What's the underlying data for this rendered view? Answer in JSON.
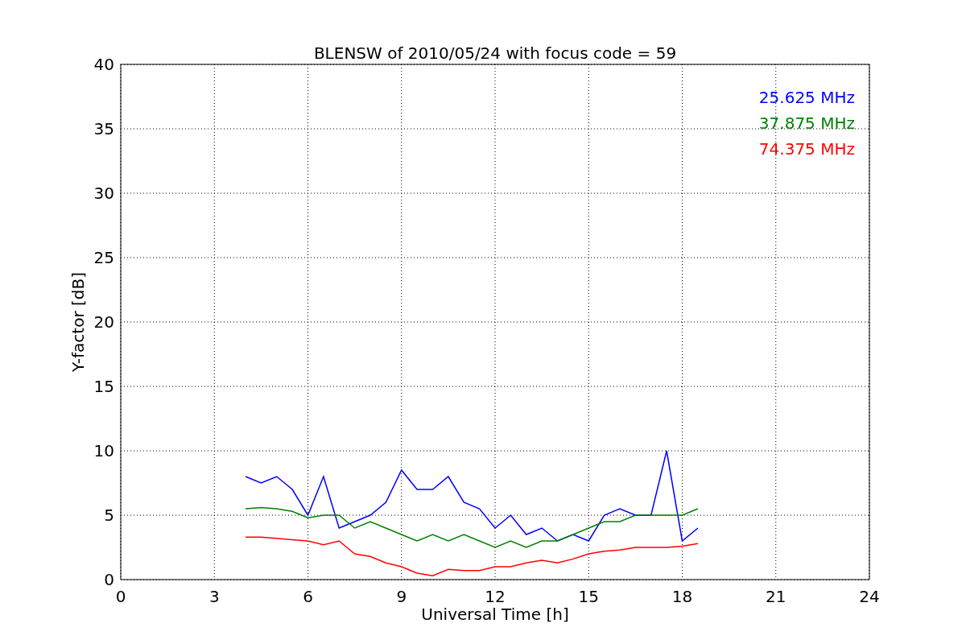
{
  "chart_data": {
    "type": "line",
    "title": "BLENSW of 2010/05/24 with focus code = 59",
    "xlabel": "Universal Time [h]",
    "ylabel": "Y-factor [dB]",
    "x": [
      4,
      4.5,
      5,
      5.5,
      6,
      6.5,
      7,
      7.5,
      8,
      8.5,
      9,
      9.5,
      10,
      10.5,
      11,
      11.5,
      12,
      12.5,
      13,
      13.5,
      14,
      14.5,
      15,
      15.5,
      16,
      16.5,
      17,
      17.5,
      18,
      18.5
    ],
    "series": [
      {
        "name": "25.625 MHz",
        "color": "#0000ff",
        "values": [
          8,
          7.5,
          8,
          7,
          5,
          8,
          4,
          4.5,
          5,
          6,
          8.5,
          7,
          7,
          8,
          6,
          5.5,
          4,
          5,
          3.5,
          4,
          3,
          3.5,
          3,
          5,
          5.5,
          5,
          5,
          10,
          3,
          4
        ]
      },
      {
        "name": "37.875 MHz",
        "color": "#008000",
        "values": [
          5.5,
          5.6,
          5.5,
          5.3,
          4.8,
          5,
          5,
          4,
          4.5,
          4,
          3.5,
          3,
          3.5,
          3,
          3.5,
          3,
          2.5,
          3,
          2.5,
          3,
          3,
          3.5,
          4,
          4.5,
          4.5,
          5,
          5,
          5,
          5,
          5.5
        ]
      },
      {
        "name": "74.375 MHz",
        "color": "#ff0000",
        "values": [
          3.3,
          3.3,
          3.2,
          3.1,
          3,
          2.7,
          3,
          2,
          1.8,
          1.3,
          1,
          0.5,
          0.3,
          0.8,
          0.7,
          0.7,
          1,
          1,
          1.3,
          1.5,
          1.3,
          1.6,
          2,
          2.2,
          2.3,
          2.5,
          2.5,
          2.5,
          2.6,
          2.8
        ]
      }
    ],
    "grid": true,
    "xlim": [
      0,
      24
    ],
    "ylim": [
      0,
      40
    ],
    "xticks": [
      0,
      3,
      6,
      9,
      12,
      15,
      18,
      21,
      24
    ],
    "yticks": [
      0,
      5,
      10,
      15,
      20,
      25,
      30,
      35,
      40
    ]
  }
}
